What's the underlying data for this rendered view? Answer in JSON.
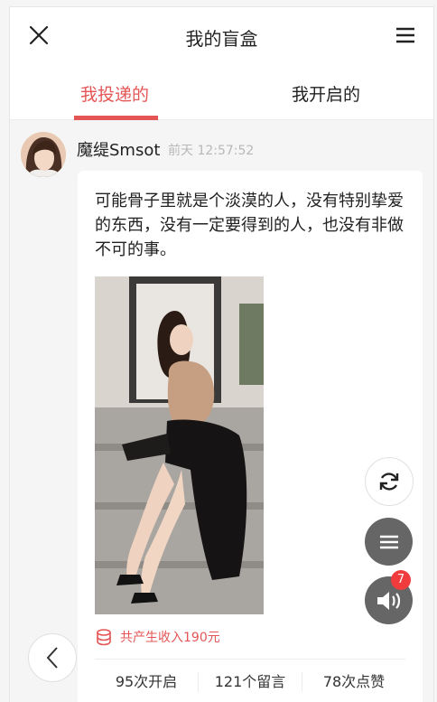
{
  "header": {
    "title": "我的盲盒"
  },
  "tabs": [
    {
      "label": "我投递的",
      "active": true
    },
    {
      "label": "我开启的",
      "active": false
    }
  ],
  "post": {
    "username": "魔缇Smsot",
    "timestamp": "前天 12:57:52",
    "text": "可能骨子里就是个淡漠的人，没有特别挚爱的东西，没有一定要得到的人，也没有非做不可的事。",
    "income": "共产生收入190元",
    "stats": {
      "opens": "95次开启",
      "comments": "121个留言",
      "likes": "78次点赞"
    }
  },
  "floating": {
    "notification_count": "7"
  },
  "colors": {
    "accent": "#e45656",
    "fab_dark": "#666666",
    "badge": "#f03c3c"
  }
}
